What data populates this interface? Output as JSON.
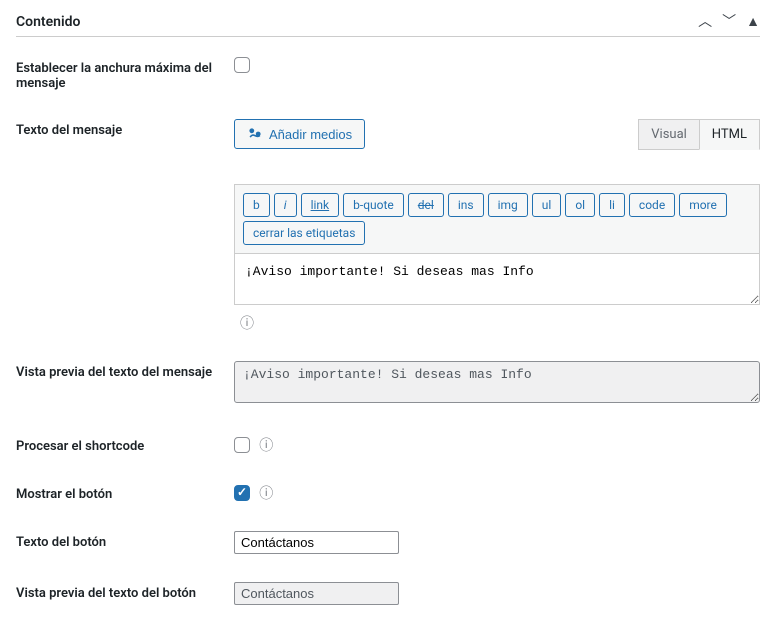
{
  "panel": {
    "title": "Contenido"
  },
  "fields": {
    "max_width": {
      "label": "Establecer la anchura máxima del mensaje",
      "checked": false
    },
    "message_text": {
      "label": "Texto del mensaje",
      "add_media": "Añadir medios",
      "tabs": {
        "visual": "Visual",
        "html": "HTML"
      },
      "qt": {
        "b": "b",
        "i": "i",
        "link": "link",
        "bquote": "b-quote",
        "del": "del",
        "ins": "ins",
        "img": "img",
        "ul": "ul",
        "ol": "ol",
        "li": "li",
        "code": "code",
        "more": "more",
        "close": "cerrar las etiquetas"
      },
      "value": "¡Aviso importante! Si deseas mas Info"
    },
    "message_preview": {
      "label": "Vista previa del texto del mensaje",
      "value": "¡Aviso importante! Si deseas mas Info"
    },
    "process_shortcode": {
      "label": "Procesar el shortcode",
      "checked": false
    },
    "show_button": {
      "label": "Mostrar el botón",
      "checked": true
    },
    "button_text": {
      "label": "Texto del botón",
      "value": "Contáctanos"
    },
    "button_preview": {
      "label": "Vista previa del texto del botón",
      "value": "Contáctanos"
    }
  }
}
